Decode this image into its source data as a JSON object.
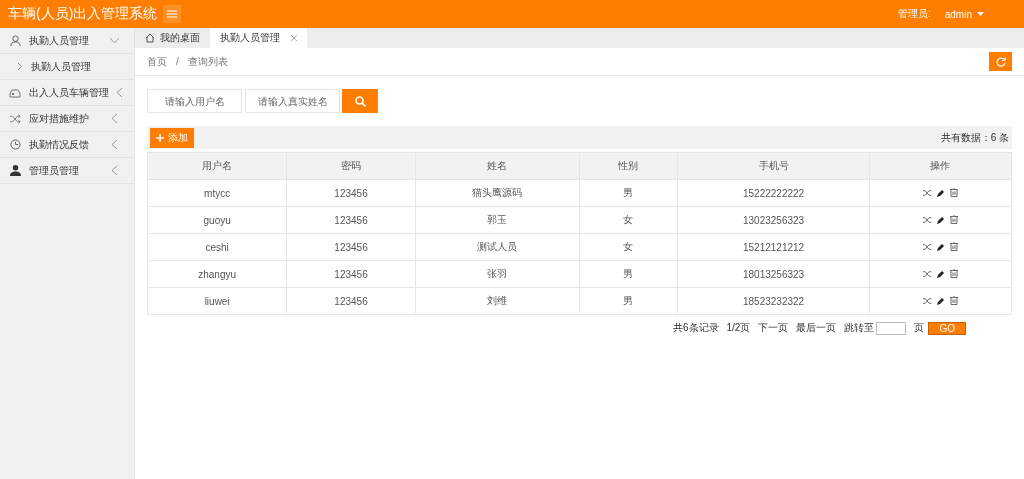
{
  "header": {
    "title": "车辆(人员)出入管理系统",
    "admin_label": "管理员:",
    "user": "admin"
  },
  "sidebar": {
    "items": [
      {
        "label": "执勤人员管理",
        "kind": "user",
        "expanded": true,
        "children": [
          {
            "label": "执勤人员管理"
          }
        ]
      },
      {
        "label": "出入人员车辆管理",
        "kind": "car",
        "expanded": false
      },
      {
        "label": "应对措施维护",
        "kind": "shuffle",
        "expanded": false
      },
      {
        "label": "执勤情况反馈",
        "kind": "clock",
        "expanded": false
      },
      {
        "label": "管理员管理",
        "kind": "admin",
        "expanded": false
      }
    ]
  },
  "tabs": [
    {
      "label": "我的桌面",
      "kind": "home",
      "selected": false
    },
    {
      "label": "执勤人员管理",
      "kind": "closable",
      "selected": true
    }
  ],
  "breadcrumb": {
    "items": [
      "首页",
      "查询列表"
    ],
    "separator": "/"
  },
  "search": {
    "fields": [
      {
        "placeholder": "请输入用户名"
      },
      {
        "placeholder": "请输入真实姓名"
      }
    ]
  },
  "toolbar": {
    "add_button": "添加",
    "total": "共有数据：6 条"
  },
  "table": {
    "columns": [
      "用户名",
      "密码",
      "姓名",
      "性别",
      "手机号",
      "操作"
    ],
    "rows": [
      [
        "mtycc",
        "123456",
        "猫头鹰源码",
        "男",
        "15222222222"
      ],
      [
        "guoyu",
        "123456",
        "郭玉",
        "女",
        "13023256323"
      ],
      [
        "ceshi",
        "123456",
        "测试人员",
        "女",
        "15212121212"
      ],
      [
        "zhangyu",
        "123456",
        "张羽",
        "男",
        "18013256323"
      ],
      [
        "liuwei",
        "123456",
        "刘维",
        "男",
        "18523232322"
      ]
    ]
  },
  "pagination": {
    "summary": "共6条记录",
    "page": "1/2页",
    "next": "下一页",
    "last": "最后一页",
    "jump_label": "跳转至",
    "unit": "页",
    "go": "GO"
  }
}
